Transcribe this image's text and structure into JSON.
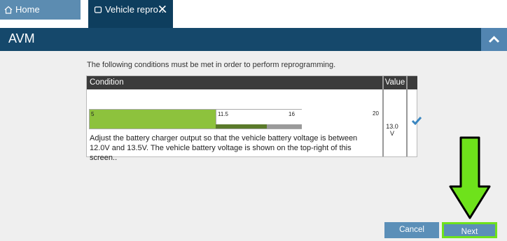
{
  "tabs": [
    {
      "label": "Home",
      "icon": "home-icon"
    },
    {
      "label": "Vehicle repro…",
      "icon": "window-icon",
      "close": "✕"
    }
  ],
  "header": {
    "title": "AVM"
  },
  "intro": "The following conditions must be met in order to perform reprogramming.",
  "table": {
    "col_condition": "Condition",
    "col_value": "Value",
    "row": {
      "bar_ticks": [
        "5",
        "11.5",
        "16",
        "20"
      ],
      "description": "Adjust the battery charger output so that the vehicle battery voltage is between 12.0V and 13.5V. The vehicle battery voltage is shown on the top-right of this screen..",
      "value_line1": "13.0",
      "value_line2": "V",
      "status": "check-icon"
    }
  },
  "buttons": {
    "cancel": "Cancel",
    "next": "Next"
  },
  "colors": {
    "accent": "#15486b",
    "button": "#5b8fb8",
    "highlight": "#6ee21b",
    "bar": "#8dc23d"
  }
}
